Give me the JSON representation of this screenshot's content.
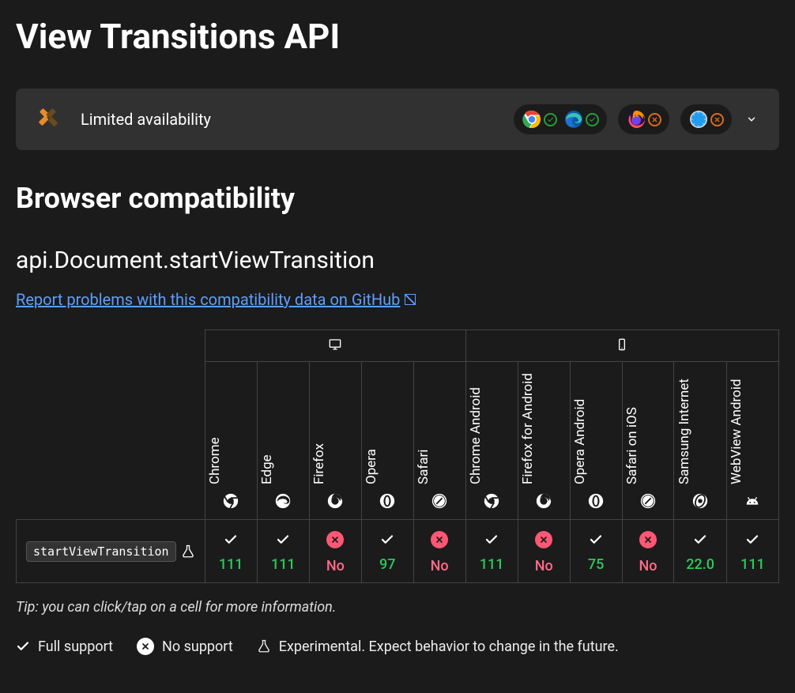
{
  "page_title": "View Transitions API",
  "baseline": {
    "label": "Limited availability",
    "groups": [
      {
        "browsers": [
          {
            "name": "chrome",
            "status": "yes"
          },
          {
            "name": "edge",
            "status": "yes"
          }
        ]
      },
      {
        "browsers": [
          {
            "name": "firefox",
            "status": "no"
          }
        ]
      },
      {
        "browsers": [
          {
            "name": "safari",
            "status": "no"
          }
        ]
      }
    ]
  },
  "section_title": "Browser compatibility",
  "api_path": "api.Document.startViewTransition",
  "report_link_text": "Report problems with this compatibility data on GitHub",
  "platforms": [
    {
      "id": "desktop",
      "span": 5
    },
    {
      "id": "mobile",
      "span": 6
    }
  ],
  "browsers": [
    {
      "id": "chrome",
      "label": "Chrome"
    },
    {
      "id": "edge",
      "label": "Edge"
    },
    {
      "id": "firefox",
      "label": "Firefox"
    },
    {
      "id": "opera",
      "label": "Opera"
    },
    {
      "id": "safari",
      "label": "Safari"
    },
    {
      "id": "chrome_android",
      "label": "Chrome Android"
    },
    {
      "id": "firefox_android",
      "label": "Firefox for Android"
    },
    {
      "id": "opera_android",
      "label": "Opera Android"
    },
    {
      "id": "safari_ios",
      "label": "Safari on iOS"
    },
    {
      "id": "samsung_internet",
      "label": "Samsung Internet"
    },
    {
      "id": "webview_android",
      "label": "WebView Android"
    }
  ],
  "rows": [
    {
      "feature": "startViewTransition",
      "experimental": true,
      "support": [
        {
          "status": "yes",
          "value": "111"
        },
        {
          "status": "yes",
          "value": "111"
        },
        {
          "status": "no",
          "value": "No"
        },
        {
          "status": "yes",
          "value": "97"
        },
        {
          "status": "no",
          "value": "No"
        },
        {
          "status": "yes",
          "value": "111"
        },
        {
          "status": "no",
          "value": "No"
        },
        {
          "status": "yes",
          "value": "75"
        },
        {
          "status": "no",
          "value": "No"
        },
        {
          "status": "yes",
          "value": "22.0"
        },
        {
          "status": "yes",
          "value": "111"
        }
      ]
    }
  ],
  "tip": "Tip: you can click/tap on a cell for more information.",
  "legend": {
    "full": "Full support",
    "none": "No support",
    "experimental": "Experimental. Expect behavior to change in the future."
  }
}
